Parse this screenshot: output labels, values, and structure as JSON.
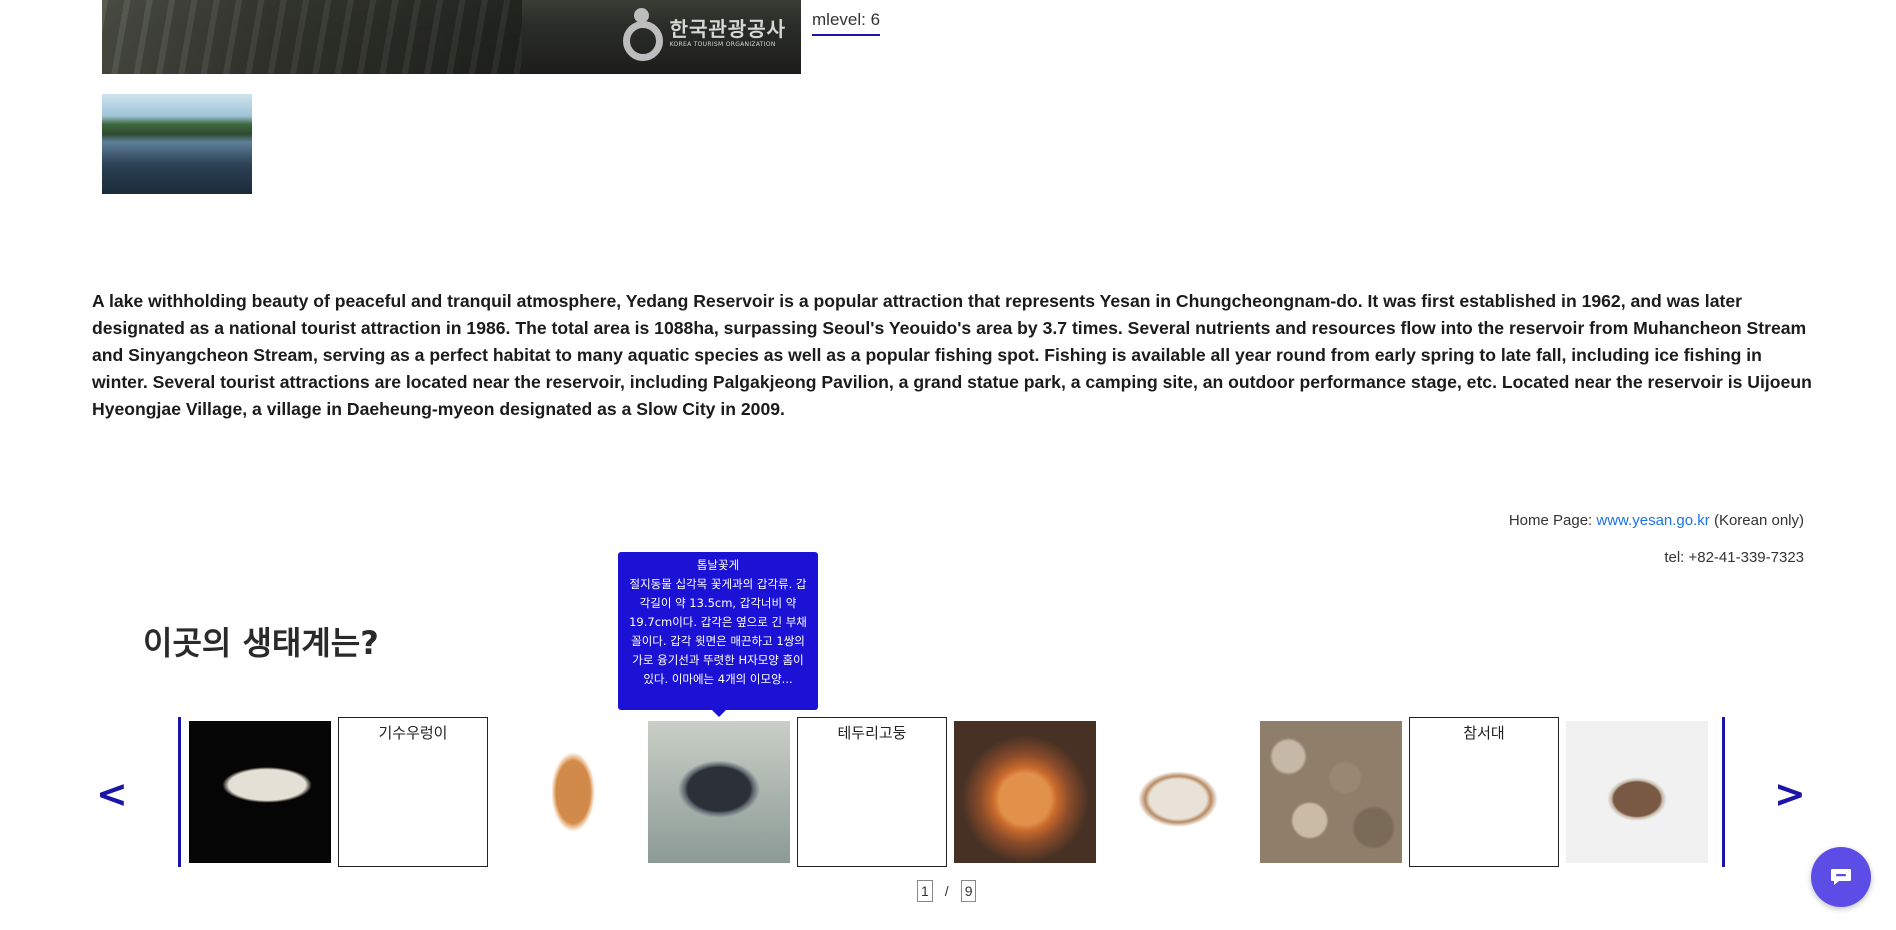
{
  "hero": {
    "logo_korean": "한국관광공사",
    "logo_english": "KOREA TOURISM ORGANIZATION"
  },
  "mlevel": "mlevel: 6",
  "description": "A lake withholding beauty of peaceful and tranquil atmosphere, Yedang Reservoir is a popular attraction that represents Yesan in Chungcheongnam-do. It was first established in 1962, and was later designated as a national tourist attraction in 1986. The total area is 1088ha, surpassing Seoul's Yeouido's area by 3.7 times. Several nutrients and resources flow into the reservoir from Muhancheon Stream and Sinyangcheon Stream, serving as a perfect habitat to many aquatic species as well as a popular fishing spot. Fishing is available all year round from early spring to late fall, including ice fishing in winter. Several tourist attractions are located near the reservoir, including Palgakjeong Pavilion, a grand statue park, a camping site, an outdoor performance stage, etc. Located near the reservoir is Uijoeun Hyeongjae Village, a village in Daeheung-myeon designated as a Slow City in 2009.",
  "contact": {
    "homepage_label": "Home Page: ",
    "homepage_link": "www.yesan.go.kr",
    "homepage_note": " (Korean only)",
    "tel": "tel: +82-41-339-7323"
  },
  "ecosystem": {
    "title": "이곳의 생태계는?",
    "tooltip": {
      "name": "톱날꽃게",
      "text": "절지동물 십각목 꽃게과의 갑각류. 갑각길이 약 13.5cm, 갑각너비 약 19.7cm이다. 갑각은 옆으로 긴 부채꼴이다. 갑각 윗면은 매끈하고 1쌍의 가로 융기선과 뚜렷한 H자모양 홈이 있다. 이마에는 4개의 이모양..."
    },
    "cards": [
      {
        "type": "photo",
        "label": "",
        "icon": "mantis-shrimp-photo"
      },
      {
        "type": "empty",
        "label": "기수우렁이"
      },
      {
        "type": "photo",
        "label": "",
        "icon": "crayfish-photo"
      },
      {
        "type": "photo",
        "label": "",
        "icon": "crab-photo"
      },
      {
        "type": "empty",
        "label": "테두리고둥"
      },
      {
        "type": "photo",
        "label": "",
        "icon": "scallop-photo"
      },
      {
        "type": "photo",
        "label": "",
        "icon": "whelk-shell-photo"
      },
      {
        "type": "photo",
        "label": "",
        "icon": "clams-photo"
      },
      {
        "type": "empty",
        "label": "참서대"
      },
      {
        "type": "photo",
        "label": "",
        "icon": "cockle-photo"
      }
    ],
    "prev_label": "<",
    "next_label": ">",
    "pager": {
      "current": "1",
      "separator": "/",
      "total": "9"
    }
  },
  "colors": {
    "accent": "#1a14a8",
    "tooltip_bg": "#1b12d6",
    "link": "#1a73e8",
    "chat_button": "#5b4de6"
  },
  "chat": {
    "icon": "chat-icon"
  }
}
